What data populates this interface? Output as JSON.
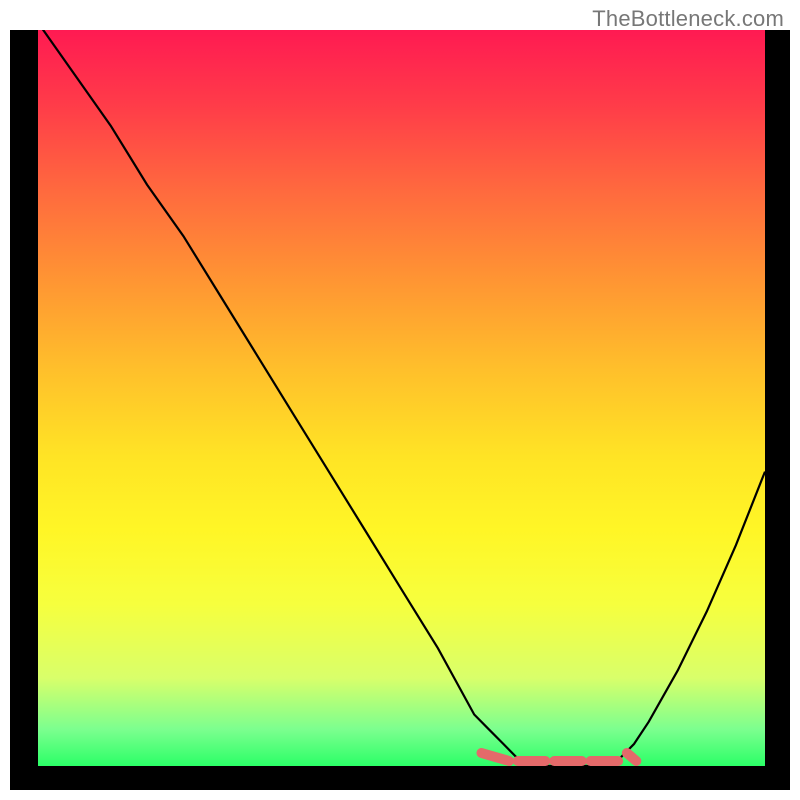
{
  "watermark": "TheBottleneck.com",
  "chart_data": {
    "type": "line",
    "title": "",
    "xlabel": "",
    "ylabel": "",
    "xlim": [
      0,
      100
    ],
    "ylim": [
      0,
      100
    ],
    "x": [
      0,
      5,
      10,
      15,
      20,
      25,
      30,
      35,
      40,
      45,
      50,
      55,
      60,
      62,
      64,
      66,
      68,
      70,
      72,
      74,
      76,
      78,
      80,
      82,
      84,
      88,
      92,
      96,
      100
    ],
    "values": [
      101,
      94,
      87,
      79,
      72,
      64,
      56,
      48,
      40,
      32,
      24,
      16,
      7,
      5,
      3,
      1,
      0,
      0,
      0,
      0,
      0,
      0,
      1,
      3,
      6,
      13,
      21,
      30,
      40
    ],
    "annotations": {
      "flat_minimum_range_x": [
        62,
        82
      ],
      "dash_segments_x": [
        [
          61,
          66
        ],
        [
          66,
          71
        ],
        [
          71,
          76
        ],
        [
          76,
          81
        ],
        [
          81,
          83.5
        ]
      ]
    },
    "colors": {
      "curve": "#000000",
      "dash": "#e46a6a",
      "gradient_top": "#ff1a52",
      "gradient_bottom": "#2bff67"
    }
  }
}
